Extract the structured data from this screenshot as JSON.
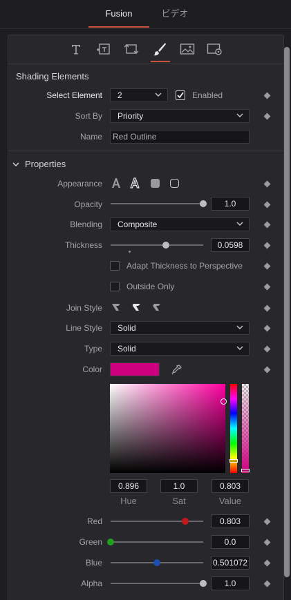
{
  "tabs": [
    {
      "label": "Fusion",
      "active": true
    },
    {
      "label": "ビデオ",
      "active": false
    }
  ],
  "tool_icons": [
    "text-icon",
    "text-plus-icon",
    "transform-icon",
    "shading-brush-icon",
    "image-icon",
    "settings-icon"
  ],
  "shading": {
    "section_title": "Shading Elements",
    "select_element_label": "Select Element",
    "select_element_value": "2",
    "enabled_label": "Enabled",
    "enabled": true,
    "sort_by_label": "Sort By",
    "sort_by_value": "Priority",
    "name_label": "Name",
    "name_value": "Red Outline"
  },
  "properties": {
    "section_title": "Properties",
    "appearance_label": "Appearance",
    "appearance_options": [
      "text-fill-icon",
      "text-outline-icon",
      "rounded-rect-fill-icon",
      "rounded-rect-outline-icon"
    ],
    "opacity_label": "Opacity",
    "opacity_value": "1.0",
    "opacity_level": 1.0,
    "blending_label": "Blending",
    "blending_value": "Composite",
    "thickness_label": "Thickness",
    "thickness_value": "0.0598",
    "thickness_level": 0.6,
    "adapt_label": "Adapt Thickness to Perspective",
    "outside_label": "Outside Only",
    "join_style_label": "Join Style",
    "line_style_label": "Line Style",
    "line_style_value": "Solid",
    "type_label": "Type",
    "type_value": "Solid",
    "color_label": "Color",
    "color_hex": "#cd0080",
    "hue_value": "0.896",
    "sat_value": "1.0",
    "val_value": "0.803",
    "hue_caption": "Hue",
    "sat_caption": "Sat",
    "val_caption": "Value",
    "red_label": "Red",
    "red_value": "0.803",
    "red_level": 0.803,
    "green_label": "Green",
    "green_value": "0.0",
    "green_level": 0.0,
    "blue_label": "Blue",
    "blue_value": "0.501072",
    "blue_level": 0.501,
    "alpha_label": "Alpha",
    "alpha_value": "1.0",
    "alpha_level": 1.0
  },
  "colors": {
    "accent": "#c9533c",
    "red_knob": "#c0191e",
    "green_knob": "#21a01e",
    "blue_knob": "#1c4fb3"
  }
}
